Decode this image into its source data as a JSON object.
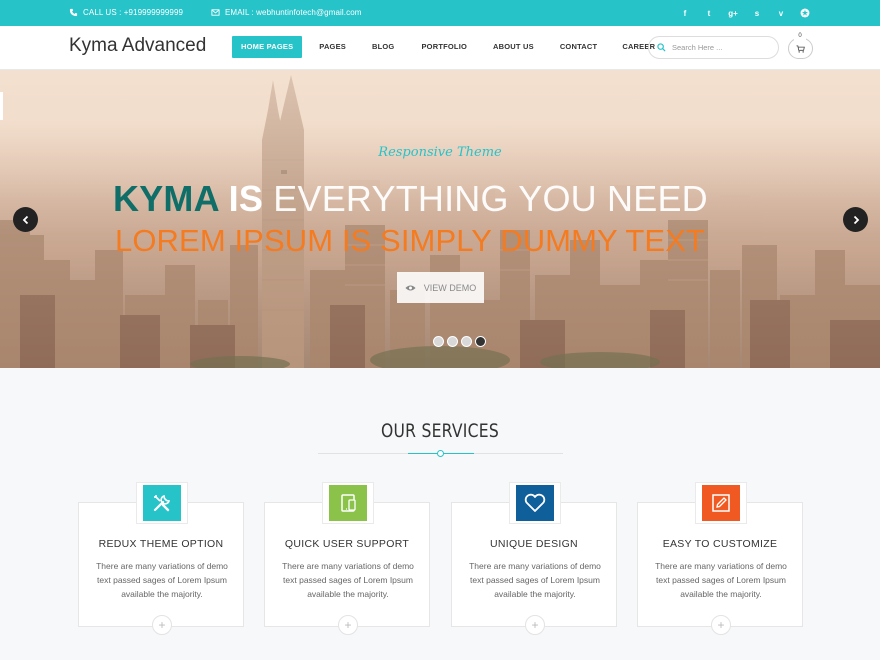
{
  "topbar": {
    "phone_label": "CALL US : +919999999999",
    "email_label": "EMAIL :  webhuntinfotech@gmail.com",
    "socials": [
      "facebook-icon",
      "twitter-icon",
      "google-plus-icon",
      "skype-icon",
      "vimeo-icon",
      "dribbble-icon"
    ],
    "social_glyphs": [
      "f",
      "t",
      "g+",
      "s",
      "v",
      "✪"
    ]
  },
  "header": {
    "logo": "Kyma Advanced",
    "nav": [
      "HOME PAGES",
      "PAGES",
      "BLOG",
      "PORTFOLIO",
      "ABOUT US",
      "CONTACT",
      "CAREER"
    ],
    "active_nav": "HOME PAGES",
    "search_placeholder": "Search Here ...",
    "cart_count": "0"
  },
  "hero": {
    "tagline": "Responsive Theme",
    "headline_part1": "KYMA",
    "headline_part2": "IS",
    "headline_part3": "EVERYTHING YOU NEED",
    "subline": "LOREM IPSUM IS SIMPLY DUMMY TEXT",
    "button_label": "VIEW DEMO",
    "slide_count": 4,
    "active_slide": 4
  },
  "services": {
    "title": "OUR SERVICES",
    "items": [
      {
        "title": "REDUX THEME OPTION",
        "text": "There are many variations of demo text passed sages of Lorem Ipsum available the majority.",
        "icon": "tools-icon",
        "color": "#26c3c9"
      },
      {
        "title": "QUICK USER SUPPORT",
        "text": "There are many variations of demo text passed sages of Lorem Ipsum available the majority.",
        "icon": "devices-icon",
        "color": "#8bc34a"
      },
      {
        "title": "UNIQUE DESIGN",
        "text": "There are many variations of demo text passed sages of Lorem Ipsum available the majority.",
        "icon": "heart-icon",
        "color": "#0e5f9a"
      },
      {
        "title": "EASY TO CUSTOMIZE",
        "text": "There are many variations of demo text passed sages of Lorem Ipsum available the majority.",
        "icon": "pencil-icon",
        "color": "#f05a22"
      }
    ]
  },
  "colors": {
    "accent": "#26c3c9",
    "headline_dark": "#0f6e68",
    "subline": "#f47b20"
  }
}
